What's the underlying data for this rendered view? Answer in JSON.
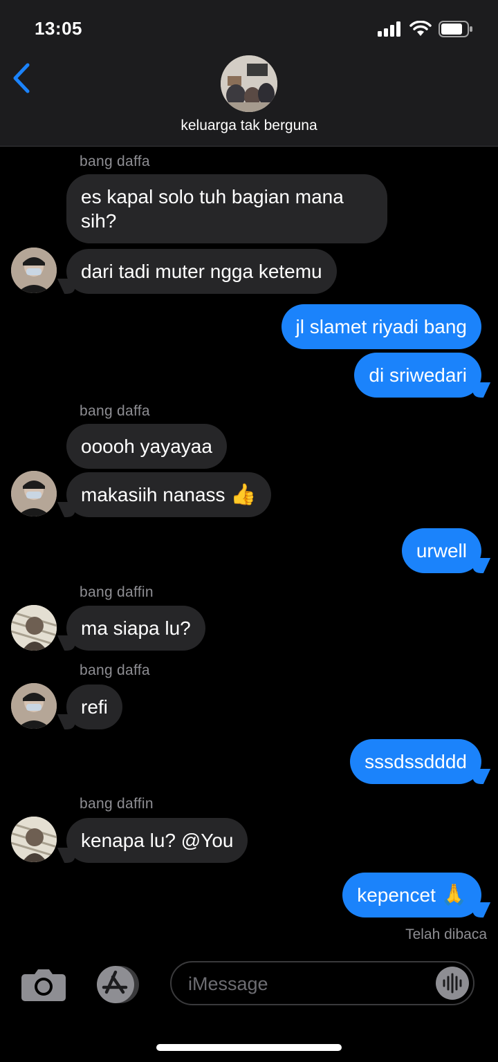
{
  "status_bar": {
    "time": "13:05"
  },
  "header": {
    "group_name": "keluarga tak berguna"
  },
  "messages": [
    {
      "sender": "bang daffa",
      "text": "es kapal solo tuh bagian mana sih?"
    },
    {
      "text": "dari tadi muter ngga ketemu"
    },
    {
      "text": "jl slamet riyadi bang"
    },
    {
      "text": "di sriwedari"
    },
    {
      "sender": "bang daffa",
      "text": "ooooh yayayaa"
    },
    {
      "text": "makasiih nanass",
      "emoji": "👍"
    },
    {
      "text": "urwell"
    },
    {
      "sender": "bang daffin",
      "text": "ma siapa lu?"
    },
    {
      "sender": "bang daffa",
      "text": "refi"
    },
    {
      "text": "sssdssdddd"
    },
    {
      "sender": "bang daffin",
      "text": "kenapa lu? @You"
    },
    {
      "text": "kepencet",
      "emoji": "🙏"
    }
  ],
  "read_receipt": "Telah dibaca",
  "composer": {
    "placeholder": "iMessage"
  },
  "colors": {
    "outgoing": "#1b83fb",
    "incoming": "#262628",
    "accent": "#1b83fb"
  },
  "icons": [
    "back-chevron-icon",
    "camera-icon",
    "app-store-icon",
    "audio-waveform-icon"
  ]
}
